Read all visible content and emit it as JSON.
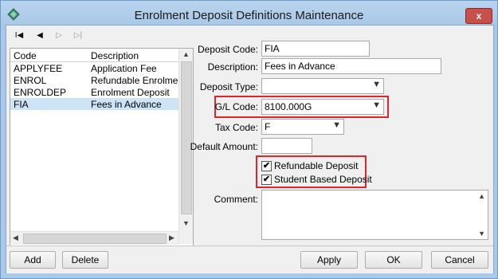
{
  "window": {
    "title": "Enrolment Deposit Definitions Maintenance",
    "close_label": "x"
  },
  "toolbar": {
    "first": "I◀",
    "prev": "◀",
    "next": "▷",
    "last": "▷|"
  },
  "list": {
    "headers": {
      "code": "Code",
      "description": "Description"
    },
    "rows": [
      {
        "code": "APPLYFEE",
        "description": "Application Fee"
      },
      {
        "code": "ENROL",
        "description": "Refundable Enrolment D"
      },
      {
        "code": "ENROLDEP",
        "description": "Enrolment Deposit"
      },
      {
        "code": "FIA",
        "description": "Fees in Advance"
      }
    ],
    "selected_index": 3
  },
  "form": {
    "deposit_code": {
      "label": "Deposit Code:",
      "value": "FIA"
    },
    "description": {
      "label": "Description:",
      "value": "Fees in Advance"
    },
    "deposit_type": {
      "label": "Deposit Type:",
      "value": ""
    },
    "gl_code": {
      "label": "G/L Code:",
      "value": "8100.000G"
    },
    "tax_code": {
      "label": "Tax Code:",
      "value": "F"
    },
    "default_amount": {
      "label": "Default Amount:",
      "value": ""
    },
    "refundable": {
      "label": "Refundable Deposit",
      "checked": true,
      "mark": "✔"
    },
    "student_based": {
      "label": "Student Based Deposit",
      "checked": true,
      "mark": "✔"
    },
    "comment": {
      "label": "Comment:",
      "value": ""
    }
  },
  "buttons": {
    "add": "Add",
    "delete": "Delete",
    "apply": "Apply",
    "ok": "OK",
    "cancel": "Cancel"
  },
  "colors": {
    "highlight": "#e0262b",
    "selected_row": "#cde4f7",
    "titlebar": "#a9c9ea"
  }
}
